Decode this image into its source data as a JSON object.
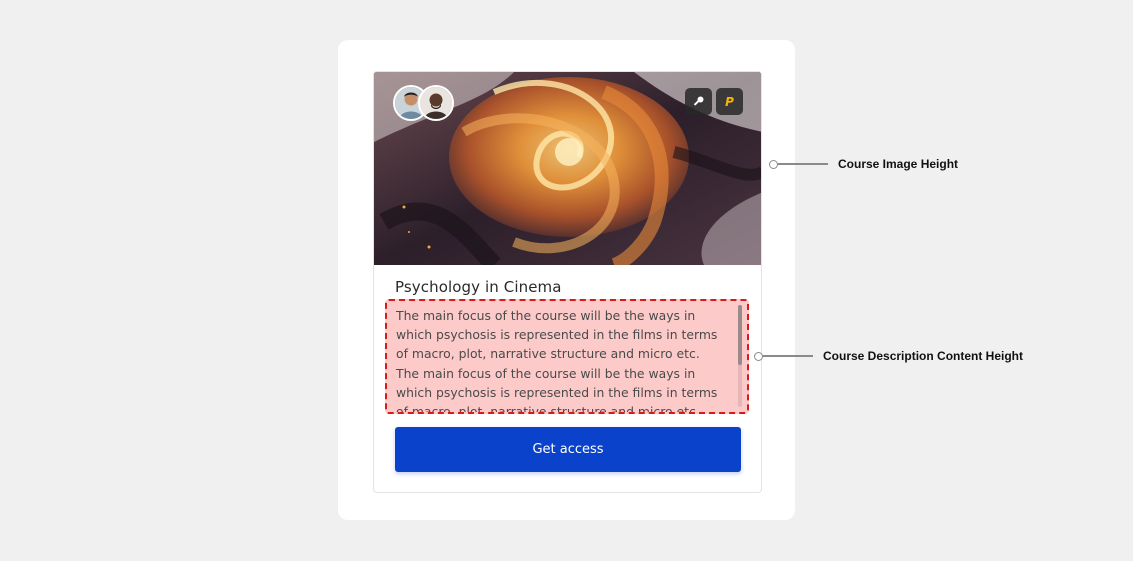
{
  "course": {
    "title": "Psychology in Cinema",
    "description": "The main focus of the course will be the ways in which psychosis is represented in the films in terms of macro, plot, narrative structure and micro etc. The main focus of the course will be the ways in which psychosis is represented in the films in terms of macro, plot, narrative structure and micro etc.",
    "cta_label": "Get access",
    "badges": [
      {
        "icon": "key-icon",
        "glyph": "⚒"
      },
      {
        "icon": "paypal-icon",
        "glyph": "P"
      }
    ],
    "avatars": [
      "instructor-avatar-1",
      "instructor-avatar-2"
    ]
  },
  "annotations": {
    "image_height_label": "Course Image Height",
    "description_height_label": "Course Description Content Height"
  },
  "colors": {
    "page_bg": "#f0f0f0",
    "cta": "#0a42cc",
    "highlight_fill": "#fdcaca",
    "highlight_border": "#d91a1a"
  }
}
